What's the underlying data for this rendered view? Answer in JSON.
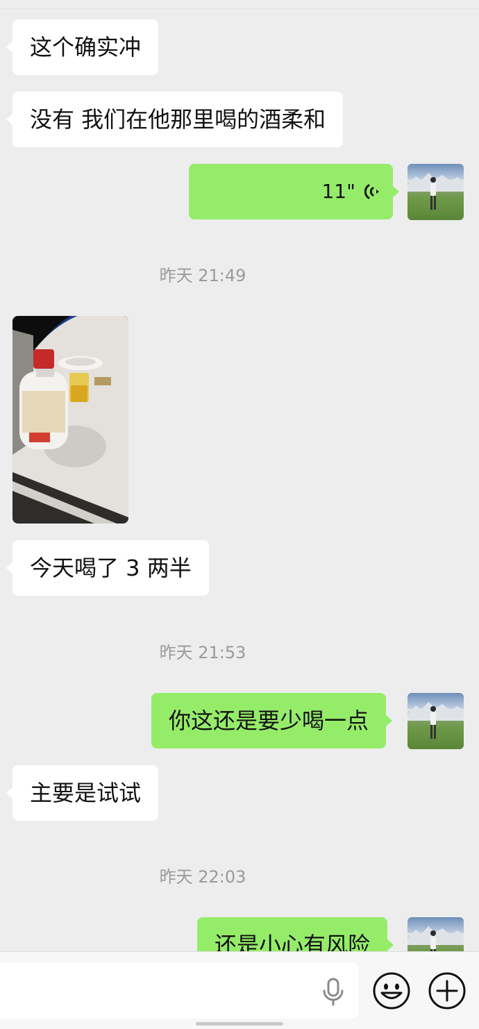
{
  "messages": [
    {
      "direction": "in",
      "text": "这个确实冲"
    },
    {
      "direction": "in",
      "text": "没有 我们在他那里喝的酒柔和"
    },
    {
      "direction": "out",
      "type": "voice",
      "duration": "11\""
    },
    {
      "type": "timestamp",
      "text": "昨天 21:49"
    },
    {
      "direction": "in",
      "type": "image",
      "subject": "liquor-bottle-and-glass-photo"
    },
    {
      "direction": "in",
      "text": "今天喝了 3 两半"
    },
    {
      "type": "timestamp",
      "text": "昨天 21:53"
    },
    {
      "direction": "out",
      "text": "你这还是要少喝一点"
    },
    {
      "direction": "in",
      "text": "主要是试试"
    },
    {
      "type": "timestamp",
      "text": "昨天 22:03"
    },
    {
      "direction": "out",
      "text": "还是小心有风险"
    }
  ],
  "input_bar": {
    "placeholder": "",
    "icons": [
      "microphone-icon",
      "emoji-icon",
      "plus-icon"
    ]
  },
  "colors": {
    "background": "#ededed",
    "incoming_bubble": "#ffffff",
    "outgoing_bubble": "#95ec69",
    "timestamp_text": "#9a9a9a"
  }
}
